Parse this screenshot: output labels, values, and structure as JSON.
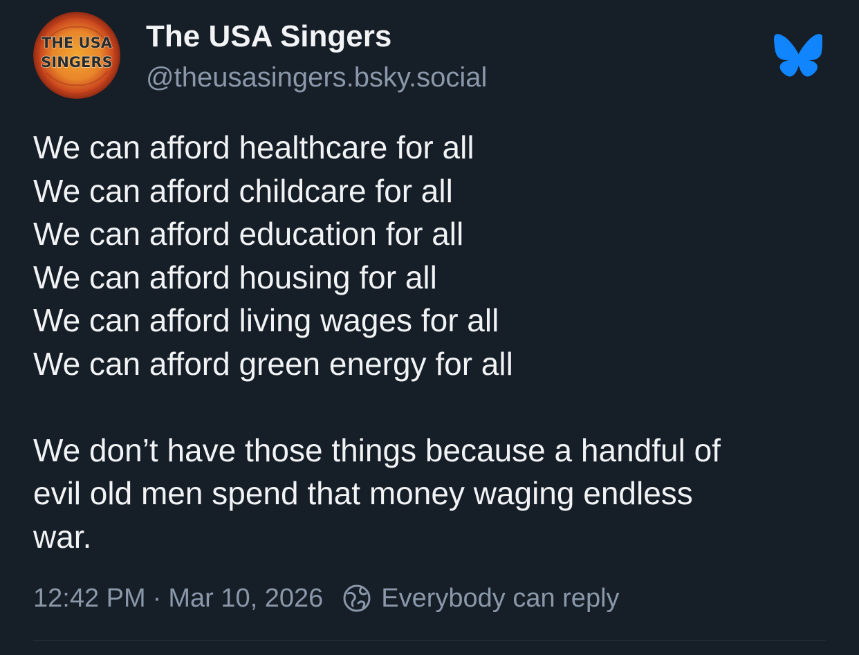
{
  "author": {
    "display_name": "The USA Singers",
    "handle": "@theusasingers.bsky.social",
    "avatar_text": [
      "THE USA",
      "SINGERS"
    ]
  },
  "icons": {
    "app": "bluesky-butterfly-icon",
    "reply_setting": "globe-icon"
  },
  "post": {
    "lines": [
      "We can afford healthcare for all",
      "We can afford childcare for all",
      "We can afford education for all",
      "We can afford housing for all",
      "We can afford living wages for all",
      "We can afford green energy for all"
    ],
    "paragraph_lines": [
      "We don’t have those things because a handful of",
      "evil old men spend that money waging endless",
      "war."
    ]
  },
  "meta": {
    "time": "12:42 PM",
    "separator": "·",
    "date": "Mar 10, 2026",
    "reply_setting": "Everybody can reply"
  },
  "colors": {
    "background": "#161e27",
    "text": "#f1f3f5",
    "muted": "#8a98aa",
    "bluesky_blue": "#1185fe"
  }
}
